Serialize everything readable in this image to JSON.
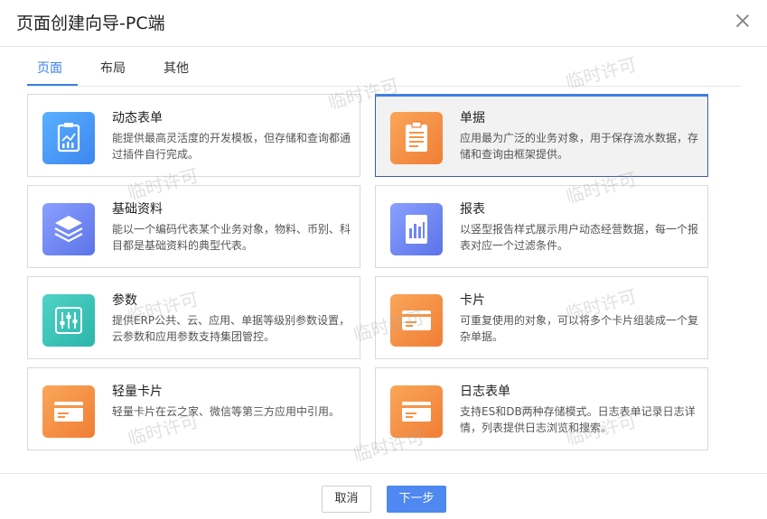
{
  "dialog": {
    "title": "页面创建向导-PC端"
  },
  "tabs": [
    {
      "label": "页面",
      "active": true
    },
    {
      "label": "布局",
      "active": false
    },
    {
      "label": "其他",
      "active": false
    }
  ],
  "cards": [
    {
      "title": "动态表单",
      "desc": "能提供最高灵活度的开发模板，但存储和查询都通过插件自行完成。",
      "icon": "dashboard-chart-icon",
      "color": "#4a9cf8"
    },
    {
      "title": "单据",
      "desc": "应用最为广泛的业务对象，用于保存流水数据，存储和查询由框架提供。",
      "icon": "clipboard-icon",
      "color": "#f59447",
      "selected": true
    },
    {
      "title": "基础资料",
      "desc": "能以一个编码代表某个业务对象，物料、币别、科目都是基础资料的典型代表。",
      "icon": "layers-icon",
      "color": "#6f86f2"
    },
    {
      "title": "报表",
      "desc": "以竖型报告样式展示用户动态经营数据，每一个报表对应一个过滤条件。",
      "icon": "bar-report-icon",
      "color": "#6f86f2"
    },
    {
      "title": "参数",
      "desc": "提供ERP公共、云、应用、单据等级别参数设置，云参数和应用参数支持集团管控。",
      "icon": "sliders-icon",
      "color": "#36c2b7"
    },
    {
      "title": "卡片",
      "desc": "可重复使用的对象，可以将多个卡片组装成一个复杂单据。",
      "icon": "card-icon",
      "color": "#f59447"
    },
    {
      "title": "轻量卡片",
      "desc": "轻量卡片在云之家、微信等第三方应用中引用。",
      "icon": "card-icon",
      "color": "#f59447"
    },
    {
      "title": "日志表单",
      "desc": "支持ES和DB两种存储模式。日志表单记录日志详情，列表提供日志浏览和搜索。",
      "icon": "card-icon",
      "color": "#f59447"
    }
  ],
  "watermark": "临时许可",
  "footer": {
    "cancel_label": "取消",
    "next_label": "下一步"
  }
}
